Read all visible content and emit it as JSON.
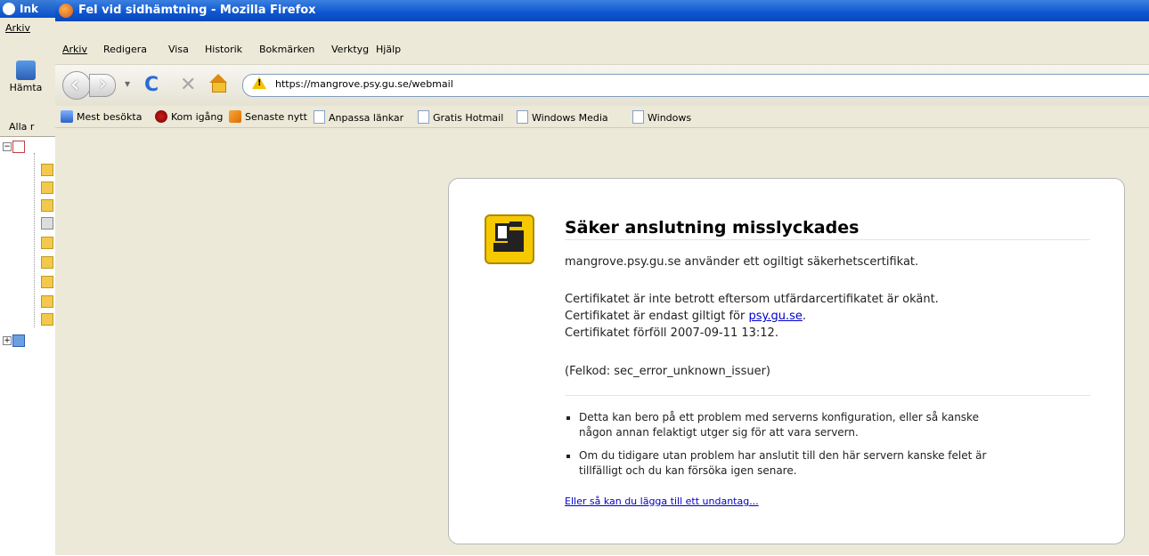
{
  "background_app": {
    "title": "Ink",
    "menu": "Arkiv",
    "get_button": "Hämta",
    "all_label": "Alla r"
  },
  "window": {
    "title": "Fel vid sidhämtning - Mozilla Firefox"
  },
  "menu": [
    "Arkiv",
    "Redigera",
    "Visa",
    "Historik",
    "Bokmärken",
    "Verktyg",
    "Hjälp"
  ],
  "address": {
    "url": "https://mangrove.psy.gu.se/webmail"
  },
  "bookmarks": [
    {
      "label": "Mest besökta",
      "icon": "folder-mest-icon"
    },
    {
      "label": "Kom igång",
      "icon": "firefox-icon"
    },
    {
      "label": "Senaste nytt",
      "icon": "rss-icon"
    },
    {
      "label": "Anpassa länkar",
      "icon": "page-icon"
    },
    {
      "label": "Gratis Hotmail",
      "icon": "page-icon"
    },
    {
      "label": "Windows Media",
      "icon": "page-icon"
    },
    {
      "label": "Windows",
      "icon": "page-icon"
    }
  ],
  "error": {
    "title": "Säker anslutning misslyckades",
    "message": "mangrove.psy.gu.se använder ett ogiltigt säkerhetscertifikat.",
    "cert_line1": "Certifikatet är inte betrott eftersom utfärdarcertifikatet är okänt.",
    "cert_line2_prefix": "Certifikatet är endast giltigt för ",
    "cert_line2_link": "psy.gu.se",
    "cert_line2_suffix": ".",
    "cert_line3": "Certifikatet förföll 2007-09-11 13:12.",
    "code": "(Felkod: sec_error_unknown_issuer)",
    "bullet1_line1": "Detta kan bero på ett problem med serverns konfiguration, eller så kanske",
    "bullet1_line2": "någon annan felaktigt utger sig för att vara servern.",
    "bullet2_line1": "Om du tidigare utan problem har anslutit till den här servern kanske felet är",
    "bullet2_line2": "tillfälligt och du kan försöka igen senare.",
    "exception_link": "Eller så kan du lägga till ett undantag..."
  },
  "colors": {
    "titlebar": "#0d55d0",
    "link": "#0000cc",
    "warning": "#f5c800"
  }
}
